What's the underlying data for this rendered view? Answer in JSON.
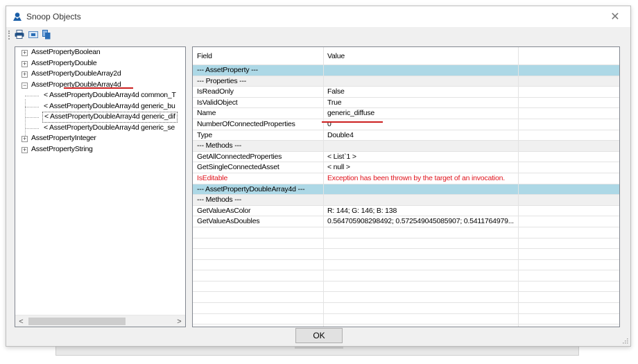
{
  "window": {
    "title": "Snoop Objects",
    "close_glyph": "✕",
    "title_icon": "snoop-person-icon",
    "accent_color": "#1b5fa8"
  },
  "toolbar": {
    "buttons": [
      {
        "icon": "print-icon"
      },
      {
        "icon": "snoop-selection-icon"
      },
      {
        "icon": "copy-icon"
      }
    ]
  },
  "tree": {
    "items": [
      {
        "label": "AssetPropertyBoolean",
        "expander": "+"
      },
      {
        "label": "AssetPropertyDouble",
        "expander": "+"
      },
      {
        "label": "AssetPropertyDoubleArray2d",
        "expander": "+"
      },
      {
        "label": "AssetPropertyDoubleArray4d",
        "expander": "−"
      },
      {
        "label": "< AssetPropertyDoubleArray4d  common_T"
      },
      {
        "label": "< AssetPropertyDoubleArray4d  generic_bu"
      },
      {
        "label": "< AssetPropertyDoubleArray4d  generic_dif"
      },
      {
        "label": "< AssetPropertyDoubleArray4d  generic_se"
      },
      {
        "label": "AssetPropertyInteger",
        "expander": "+"
      },
      {
        "label": "AssetPropertyString",
        "expander": "+"
      }
    ]
  },
  "scroll": {
    "left_glyph": "<",
    "right_glyph": ">"
  },
  "grid": {
    "headers": [
      "Field",
      "Value"
    ],
    "rows": [
      {
        "field": "--- AssetProperty ---",
        "value": ""
      },
      {
        "field": "--- Properties ---",
        "value": ""
      },
      {
        "field": "IsReadOnly",
        "value": "False"
      },
      {
        "field": "IsValidObject",
        "value": "True"
      },
      {
        "field": "Name",
        "value": "generic_diffuse"
      },
      {
        "field": "NumberOfConnectedProperties",
        "value": "0"
      },
      {
        "field": "Type",
        "value": "Double4"
      },
      {
        "field": "--- Methods ---",
        "value": ""
      },
      {
        "field": "GetAllConnectedProperties",
        "value": "< List`1 >"
      },
      {
        "field": "GetSingleConnectedAsset",
        "value": "< null >"
      },
      {
        "field": "IsEditable",
        "value": "Exception has been thrown by the target of an invocation."
      },
      {
        "field": "--- AssetPropertyDoubleArray4d ---",
        "value": ""
      },
      {
        "field": "--- Methods ---",
        "value": ""
      },
      {
        "field": "GetValueAsColor",
        "value": "R: 144; G: 146; B: 138"
      },
      {
        "field": "GetValueAsDoubles",
        "value": "0.564705908298492; 0.572549045085907; 0.5411764979..."
      }
    ]
  },
  "ok_label": "OK",
  "colors": {
    "section_bg": "#add8e6",
    "subsection_bg": "#f0f0f0",
    "error_text": "#e0131c",
    "annotation_underline": "#cc1f1f"
  }
}
